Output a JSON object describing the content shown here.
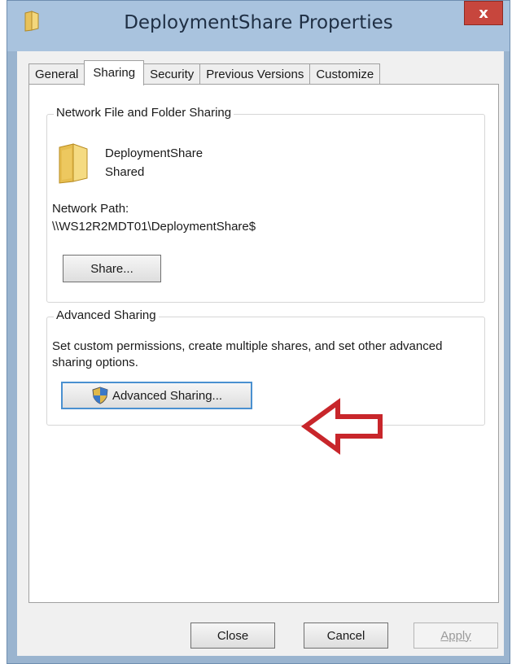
{
  "window": {
    "title": "DeploymentShare Properties",
    "close_label": "x"
  },
  "tabs": [
    {
      "label": "General",
      "active": false
    },
    {
      "label": "Sharing",
      "active": true
    },
    {
      "label": "Security",
      "active": false
    },
    {
      "label": "Previous Versions",
      "active": false
    },
    {
      "label": "Customize",
      "active": false
    }
  ],
  "network_sharing": {
    "group_label": "Network File and Folder Sharing",
    "share_name": "DeploymentShare",
    "share_status": "Shared",
    "path_label": "Network Path:",
    "path_value": "\\\\WS12R2MDT01\\DeploymentShare$",
    "share_button": "Share..."
  },
  "advanced_sharing": {
    "group_label": "Advanced Sharing",
    "description": "Set custom permissions, create multiple shares, and set other advanced sharing options.",
    "button_label": "Advanced Sharing..."
  },
  "footer": {
    "close_label": "Close",
    "cancel_label": "Cancel",
    "apply_label": "Apply"
  },
  "colors": {
    "titlebar": "#a9c3de",
    "close_button": "#c7463d",
    "annotation_arrow": "#c8262b"
  },
  "icons": [
    "folder-icon",
    "uac-shield-icon",
    "red-arrow-annotation"
  ]
}
